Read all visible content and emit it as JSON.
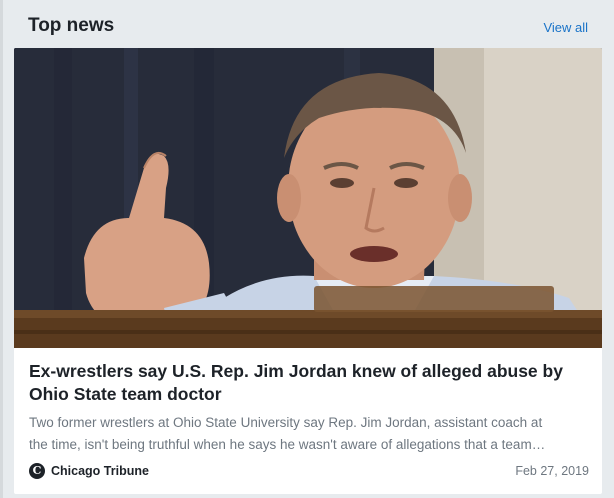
{
  "module": {
    "title": "Top news",
    "view_all_label": "View all"
  },
  "story": {
    "image_alt": "Jim Jordan pointing during a hearing",
    "headline": "Ex-wrestlers say U.S. Rep. Jim Jordan knew of alleged abuse by Ohio State team doctor",
    "summary_line1": "Two former wrestlers at Ohio State University say Rep. Jim Jordan, assistant coach at",
    "summary_line2": "the time, isn't being truthful when he says he wasn't aware of allegations that a team…",
    "source": "Chicago Tribune",
    "source_logo_glyph": "C",
    "date": "Feb 27, 2019"
  },
  "colors": {
    "accent_link": "#1a73c8",
    "headline_text": "#1d2228",
    "summary_text": "#6e7780"
  }
}
